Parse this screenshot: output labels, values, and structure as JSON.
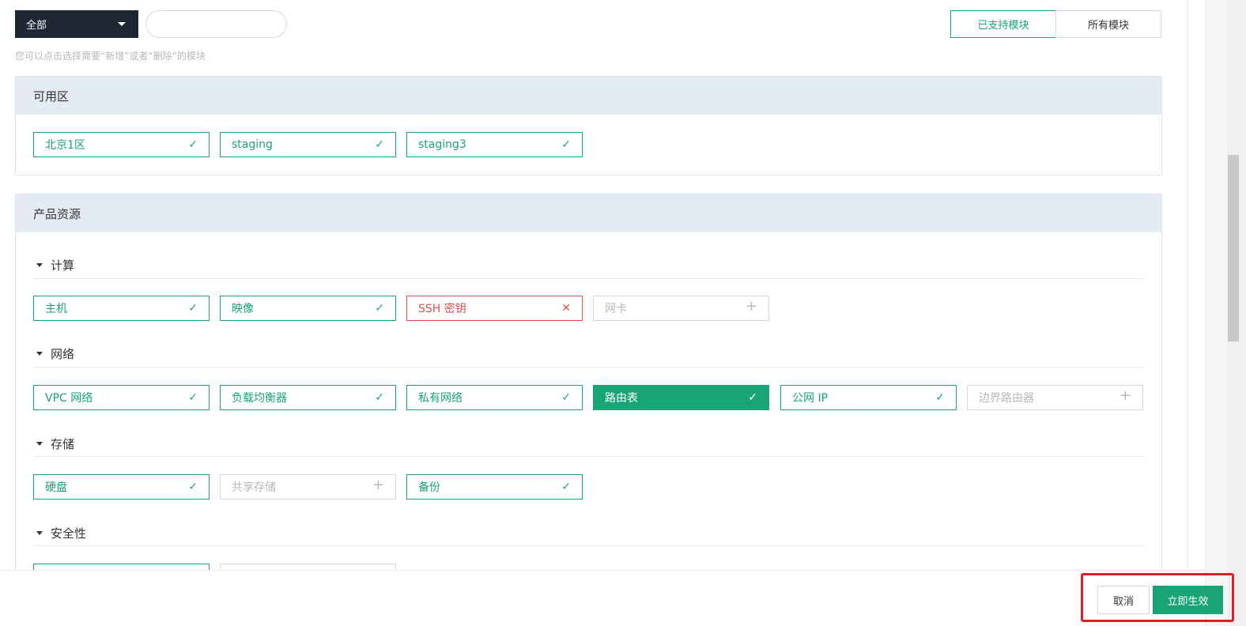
{
  "toolbar": {
    "filter_selected": "全部",
    "search_placeholder": "",
    "hint": "您可以点击选择需要“新增”或者“删除”的模块",
    "segment_supported": "已支持模块",
    "segment_all": "所有模块"
  },
  "zones": {
    "title": "可用区",
    "items": [
      {
        "label": "北京1区",
        "state": "selected"
      },
      {
        "label": "staging",
        "state": "selected"
      },
      {
        "label": "staging3",
        "state": "selected"
      }
    ]
  },
  "products": {
    "title": "产品资源",
    "groups": [
      {
        "title": "计算",
        "items": [
          {
            "label": "主机",
            "state": "selected"
          },
          {
            "label": "映像",
            "state": "selected"
          },
          {
            "label": "SSH 密钥",
            "state": "remove"
          },
          {
            "label": "网卡",
            "state": "add"
          }
        ]
      },
      {
        "title": "网络",
        "items": [
          {
            "label": "VPC 网络",
            "state": "selected"
          },
          {
            "label": "负载均衡器",
            "state": "selected"
          },
          {
            "label": "私有网络",
            "state": "selected"
          },
          {
            "label": "路由表",
            "state": "active"
          },
          {
            "label": "公网 IP",
            "state": "selected"
          },
          {
            "label": "边界路由器",
            "state": "add"
          }
        ]
      },
      {
        "title": "存储",
        "items": [
          {
            "label": "硬盘",
            "state": "selected"
          },
          {
            "label": "共享存储",
            "state": "add"
          },
          {
            "label": "备份",
            "state": "selected"
          }
        ]
      },
      {
        "title": "安全性",
        "items": []
      }
    ]
  },
  "footer": {
    "cancel_label": "取消",
    "apply_label": "立即生效"
  },
  "icons": {
    "check": "check-icon",
    "remove": "close-icon",
    "add": "plus-icon",
    "collapse": "caret-down-icon"
  },
  "colors": {
    "accent": "#19a476",
    "error": "#d9534f",
    "dropdown_bg": "#1e2533",
    "panel_header": "#e4ebf3",
    "highlight": "#e02020"
  }
}
